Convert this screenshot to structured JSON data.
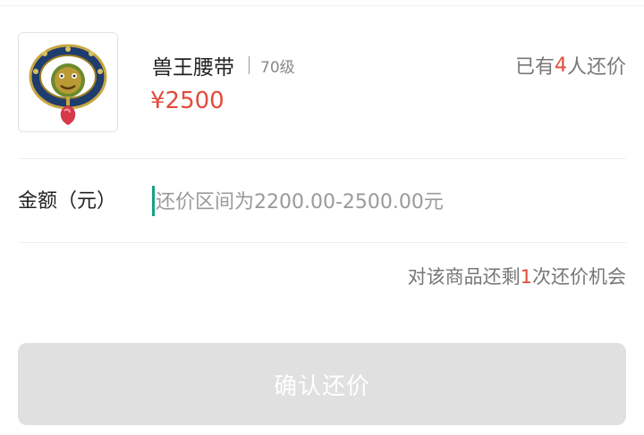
{
  "product": {
    "name": "兽王腰带",
    "level": "70级",
    "price": "¥2500",
    "offers_prefix": "已有",
    "offers_count": "4",
    "offers_suffix": "人还价",
    "icon": "lion-belt-icon"
  },
  "amount": {
    "label": "金额（元）",
    "value": "",
    "placeholder": "还价区间为2200.00-2500.00元"
  },
  "chance": {
    "prefix": "对该商品还剩",
    "count": "1",
    "suffix": "次还价机会"
  },
  "confirm": {
    "label": "确认还价"
  },
  "colors": {
    "accent_red": "#e24b3b",
    "cursor_teal": "#17a085",
    "button_disabled": "#e0e0e0"
  }
}
